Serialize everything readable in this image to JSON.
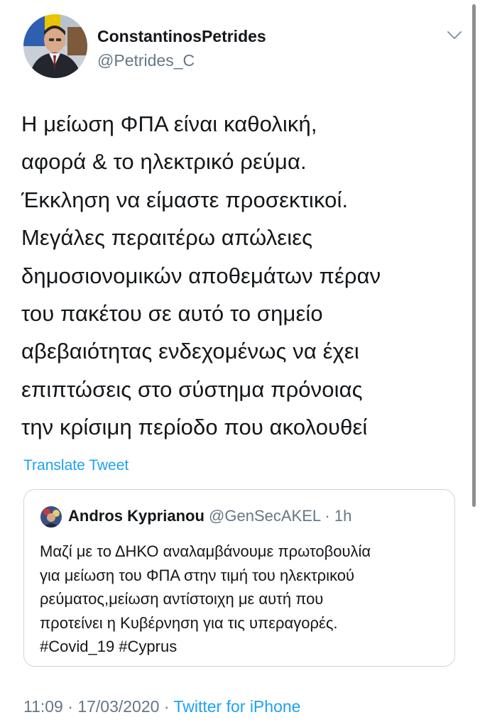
{
  "tweet": {
    "author_name": "ConstantinosPetrides",
    "author_handle": "@Petrides_C",
    "text_lines": [
      "Η μείωση ΦΠΑ είναι καθολική,",
      "αφορά & το ηλεκτρικό ρεύμα.",
      "Έκκληση να είμαστε προσεκτικοί.",
      "Μεγάλες περαιτέρω απώλειες",
      "δημοσιονομικών αποθεμάτων πέραν",
      "του πακέτου σε αυτό το σημείο",
      "αβεβαιότητας ενδεχομένως  να έχει",
      "επιπτώσεις στο σύστημα πρόνοιας",
      "την κρίσιμη περίοδο που ακολουθεί"
    ],
    "translate_label": "Translate Tweet",
    "time": "11:09",
    "date": "17/03/2020",
    "source": "Twitter for iPhone",
    "separator": " · "
  },
  "quoted": {
    "author_name": "Andros Kyprianou",
    "author_handle": "@GenSecAKEL",
    "age": "1h",
    "separator": " · ",
    "text_lines": [
      "Μαζί με το ΔΗΚΟ αναλαμβάνουμε πρωτοβουλία",
      "για μείωση του ΦΠΑ στην τιμή του ηλεκτρικού",
      "ρεύματος,μείωση αντίστοιχη με αυτή που",
      "προτείνει η Κυβέρνηση για τις υπεραγορές.",
      "#Covid_19 #Cyprus"
    ]
  },
  "icons": {
    "caret": "chevron-down-icon"
  },
  "colors": {
    "link": "#1da1f2",
    "secondary_text": "#657786",
    "primary_text": "#14171a",
    "border": "#ccd6dd"
  }
}
